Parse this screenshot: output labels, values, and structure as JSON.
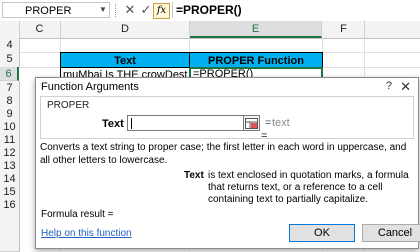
{
  "formula_bar": {
    "name_box": "PROPER",
    "name_dropdown_icon": "chevron-down-icon",
    "cancel_icon": "x-icon",
    "enter_icon": "check-icon",
    "fx_label": "fx",
    "formula": "=PROPER()"
  },
  "sheet": {
    "columns": [
      "C",
      "D",
      "E",
      "F"
    ],
    "rows": [
      "4",
      "5",
      "6",
      "7",
      "8",
      "9",
      "10",
      "11",
      "12",
      "13",
      "14",
      "15",
      "16"
    ],
    "active_column": "E",
    "active_row": "6",
    "header_row": {
      "d": "Text",
      "e": "PROPER Function"
    },
    "data_row": {
      "d": "muMbai Is THE crowDest oNE",
      "e": "=PROPER()"
    }
  },
  "dialog": {
    "title": "Function Arguments",
    "help_glyph": "?",
    "close_glyph": "✕",
    "function_name": "PROPER",
    "argument_label": "Text",
    "argument_value": "",
    "argument_eq": "=",
    "argument_hint": "text",
    "result_eq": "=",
    "description": "Converts a text string to proper case; the first letter in each word in uppercase, and all other letters to lowercase.",
    "arg_desc_name": "Text",
    "arg_desc": "is text enclosed in quotation marks, a formula that returns text, or a reference to a cell containing text to partially capitalize.",
    "formula_result_label": "Formula result =",
    "help_link": "Help on this function",
    "ok_label": "OK",
    "cancel_label": "Cancel"
  },
  "colors": {
    "header_fill": "#00b0f0",
    "active_green": "#217346",
    "link_blue": "#1f5fbf"
  }
}
